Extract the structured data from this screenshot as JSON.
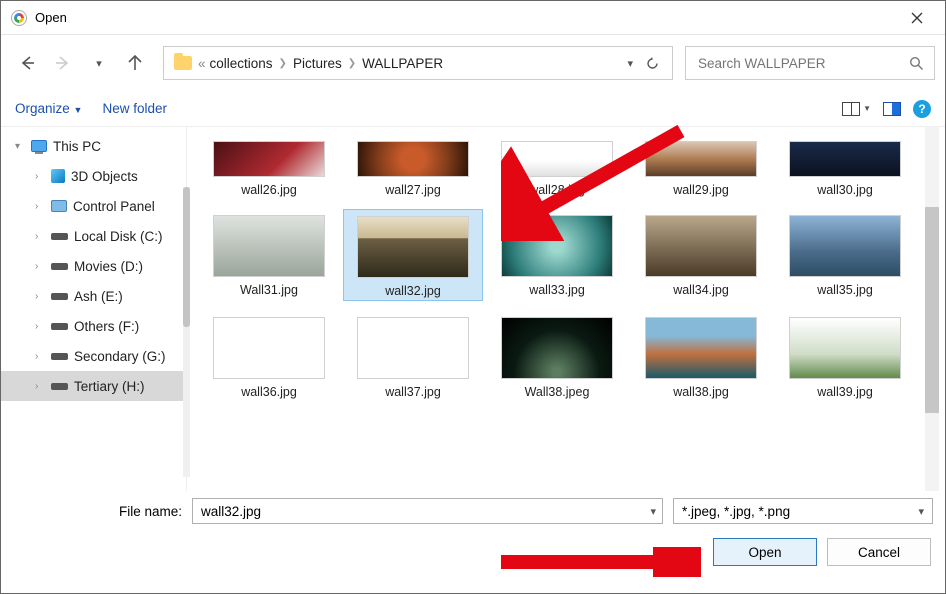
{
  "window": {
    "title": "Open"
  },
  "nav": {
    "breadcrumbs": [
      "collections",
      "Pictures",
      "WALLPAPER"
    ],
    "search_placeholder": "Search WALLPAPER"
  },
  "toolbar": {
    "organize_label": "Organize",
    "newfolder_label": "New folder"
  },
  "sidebar": {
    "root": "This PC",
    "items": [
      {
        "label": "3D Objects",
        "icon": "cube"
      },
      {
        "label": "Control Panel",
        "icon": "control-panel"
      },
      {
        "label": "Local Disk (C:)",
        "icon": "drive"
      },
      {
        "label": "Movies (D:)",
        "icon": "drive"
      },
      {
        "label": "Ash (E:)",
        "icon": "drive"
      },
      {
        "label": "Others (F:)",
        "icon": "drive"
      },
      {
        "label": "Secondary (G:)",
        "icon": "drive"
      },
      {
        "label": "Tertiary (H:)",
        "icon": "drive",
        "selected": true
      }
    ]
  },
  "files": {
    "row0": [
      {
        "name": "wall26.jpg"
      },
      {
        "name": "wall27.jpg"
      },
      {
        "name": "wall28.jpg"
      },
      {
        "name": "wall29.jpg"
      },
      {
        "name": "wall30.jpg"
      }
    ],
    "row1": [
      {
        "name": "Wall31.jpg"
      },
      {
        "name": "wall32.jpg",
        "selected": true
      },
      {
        "name": "wall33.jpg"
      },
      {
        "name": "wall34.jpg"
      },
      {
        "name": "wall35.jpg"
      }
    ],
    "row2": [
      {
        "name": "wall36.jpg"
      },
      {
        "name": "wall37.jpg"
      },
      {
        "name": "Wall38.jpeg"
      },
      {
        "name": "wall38.jpg"
      },
      {
        "name": "wall39.jpg"
      }
    ]
  },
  "footer": {
    "filename_label": "File name:",
    "filename_value": "wall32.jpg",
    "filter_value": "*.jpeg, *.jpg, *.png",
    "open_label": "Open",
    "cancel_label": "Cancel"
  },
  "thumb_bg": {
    "wall26": "linear-gradient(135deg,#4a1015,#b02a30 60%,#eadada)",
    "wall27": "radial-gradient(circle,#c95b2b 20%,#823d1a 60%,#2e1408)",
    "wall28": "linear-gradient(#ffffff 55%,#e0e0e0)",
    "wall29": "linear-gradient(0deg,#5b3d2a,#b07d52 50%,#d9c7b4)",
    "wall30": "linear-gradient(180deg,#1a2a4a,#0b1220)",
    "wall31": "linear-gradient(180deg,#dfe3e0,#9aa59a)",
    "wall32": "linear-gradient(180deg,#e8dfc8 0%,#c9b98f 35%,#6c5f45 36%,#2f2a1a 100%)",
    "wall33": "radial-gradient(circle,#9dd8cf 10%,#2d7d7a 70%,#0d3d3a)",
    "wall34": "linear-gradient(180deg,#b8a78a,#4a3b28)",
    "wall35": "linear-gradient(180deg,#8db3d6,#4a6c8a 60%,#2c4d64)",
    "wall36": "#ffffff",
    "wall37": "#ffffff",
    "wall38a": "radial-gradient(ellipse at 50% 90%,#5c7d60 5%,#0a1a12 55%,#000 100%)",
    "wall38b": "linear-gradient(180deg,#86b8d8 30%,#c07040 60%,#1a5a6a)",
    "wall39": "linear-gradient(180deg,#ffffff,#d0ddc8 60%,#628a4c)"
  }
}
